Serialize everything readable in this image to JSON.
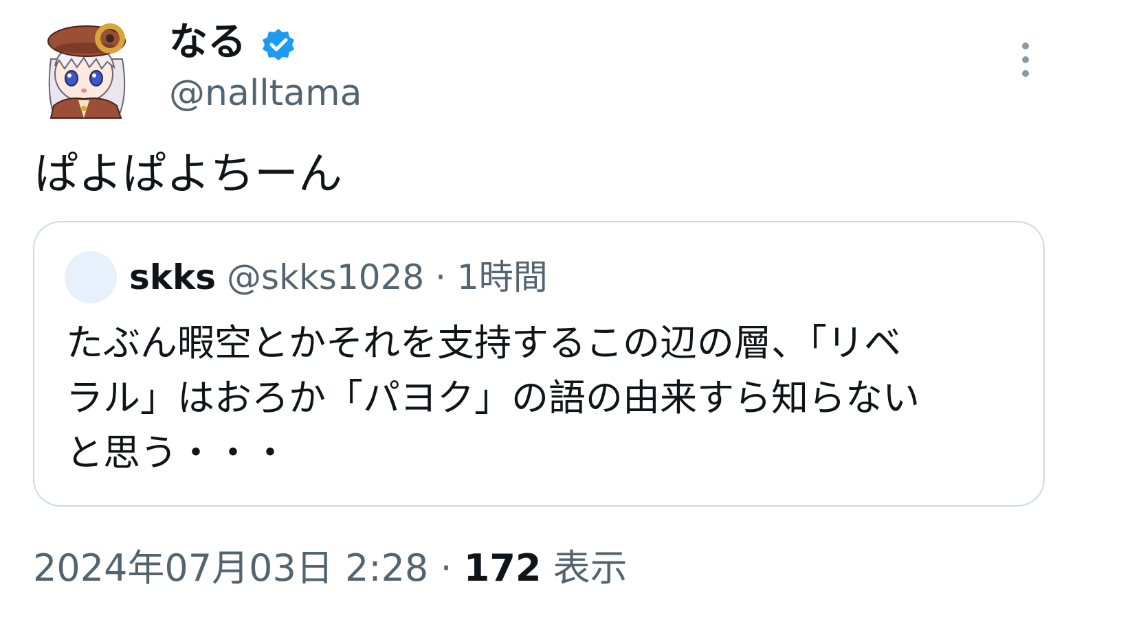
{
  "tweet": {
    "author": {
      "display_name": "なる",
      "handle": "@nalltama",
      "verified_icon": "verified-badge-icon",
      "avatar_icon": "anime-girl-avatar"
    },
    "more_icon": "more-vertical-icon",
    "text": "ぱよぱよちーん",
    "quoted": {
      "display_name": "skks",
      "handle": "@skks1028",
      "separator": " · ",
      "time": "1時間",
      "text_lines": [
        "たぶん暇空とかそれを支持するこの辺の層、「リベ",
        "ラル」はおろか「パヨク」の語の由来すら知らない",
        "と思う・・・"
      ]
    },
    "meta": {
      "datetime": "2024年07月03日 2:28",
      "separator": " · ",
      "views_count": "172",
      "views_label": " 表示"
    }
  },
  "colors": {
    "text_primary": "#0f1419",
    "text_secondary": "#536471",
    "verified_blue": "#1d9bf0",
    "border": "#cfd9de"
  }
}
